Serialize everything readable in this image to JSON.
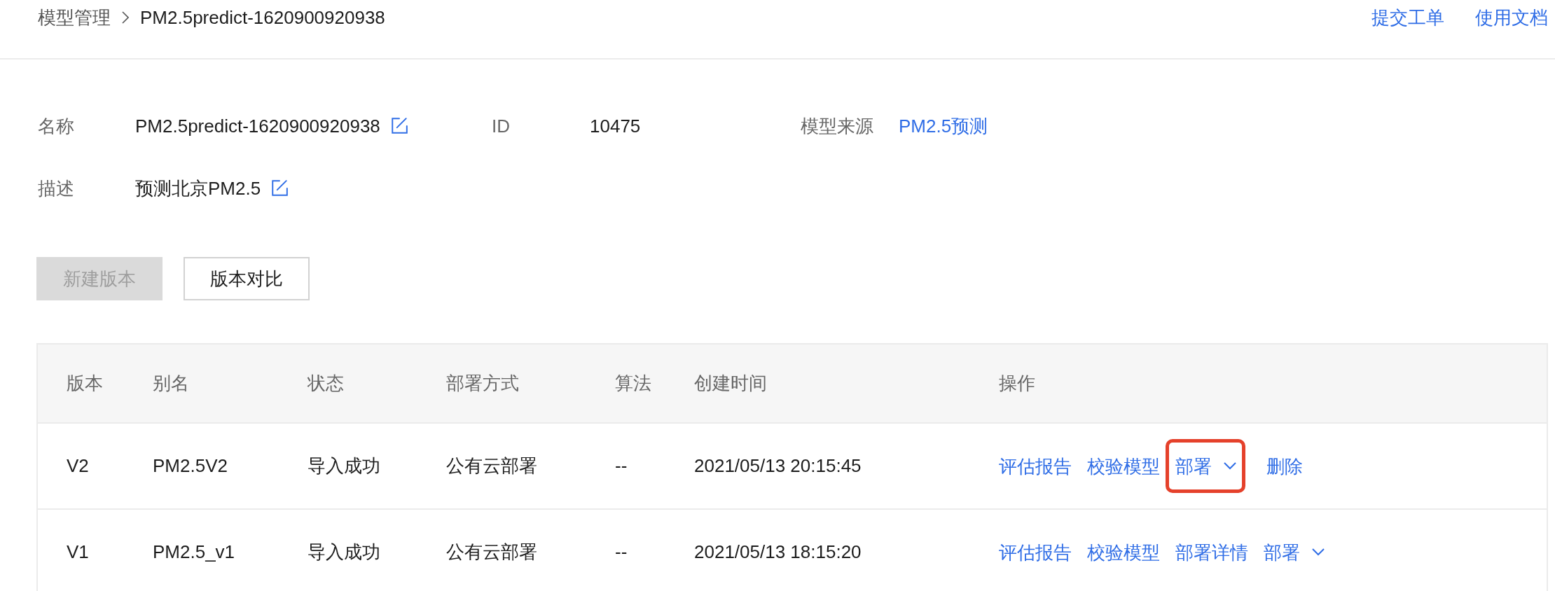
{
  "breadcrumb": [
    {
      "label": "模型管理",
      "kind": "link"
    },
    {
      "label": "PM2.5predict-1620900920938",
      "kind": "current"
    }
  ],
  "header_links": [
    "提交工单",
    "使用文档"
  ],
  "details": [
    {
      "label": "名称",
      "value": "PM2.5predict-1620900920938",
      "kind": "editable"
    },
    {
      "label": "ID",
      "value": "10475",
      "kind": "text"
    },
    {
      "label": "模型来源",
      "value": "PM2.5预测",
      "kind": "link"
    },
    {
      "label": "描述",
      "value": "预测北京PM2.5",
      "kind": "editable"
    }
  ],
  "buttons": [
    {
      "label": "新建版本",
      "disabled": true
    },
    {
      "label": "版本对比",
      "disabled": false
    }
  ],
  "table": {
    "columns": [
      "版本",
      "别名",
      "状态",
      "部署方式",
      "算法",
      "创建时间",
      "操作"
    ],
    "rows": [
      {
        "cells": [
          "V2",
          "PM2.5V2",
          "导入成功",
          "公有云部署",
          "--",
          "2021/05/13 20:15:45"
        ],
        "actions": [
          {
            "label": "评估报告",
            "kind": "link",
            "highlighted": false
          },
          {
            "label": "校验模型",
            "kind": "link",
            "highlighted": false
          },
          {
            "label": "部署",
            "kind": "dropdown",
            "highlighted": true
          },
          {
            "label": "删除",
            "kind": "link",
            "highlighted": false
          }
        ]
      },
      {
        "cells": [
          "V1",
          "PM2.5_v1",
          "导入成功",
          "公有云部署",
          "--",
          "2021/05/13 18:15:20"
        ],
        "actions": [
          {
            "label": "评估报告",
            "kind": "link",
            "highlighted": false
          },
          {
            "label": "校验模型",
            "kind": "link",
            "highlighted": false
          },
          {
            "label": "部署详情",
            "kind": "link",
            "highlighted": false
          },
          {
            "label": "部署",
            "kind": "dropdown",
            "highlighted": false
          }
        ]
      }
    ]
  }
}
